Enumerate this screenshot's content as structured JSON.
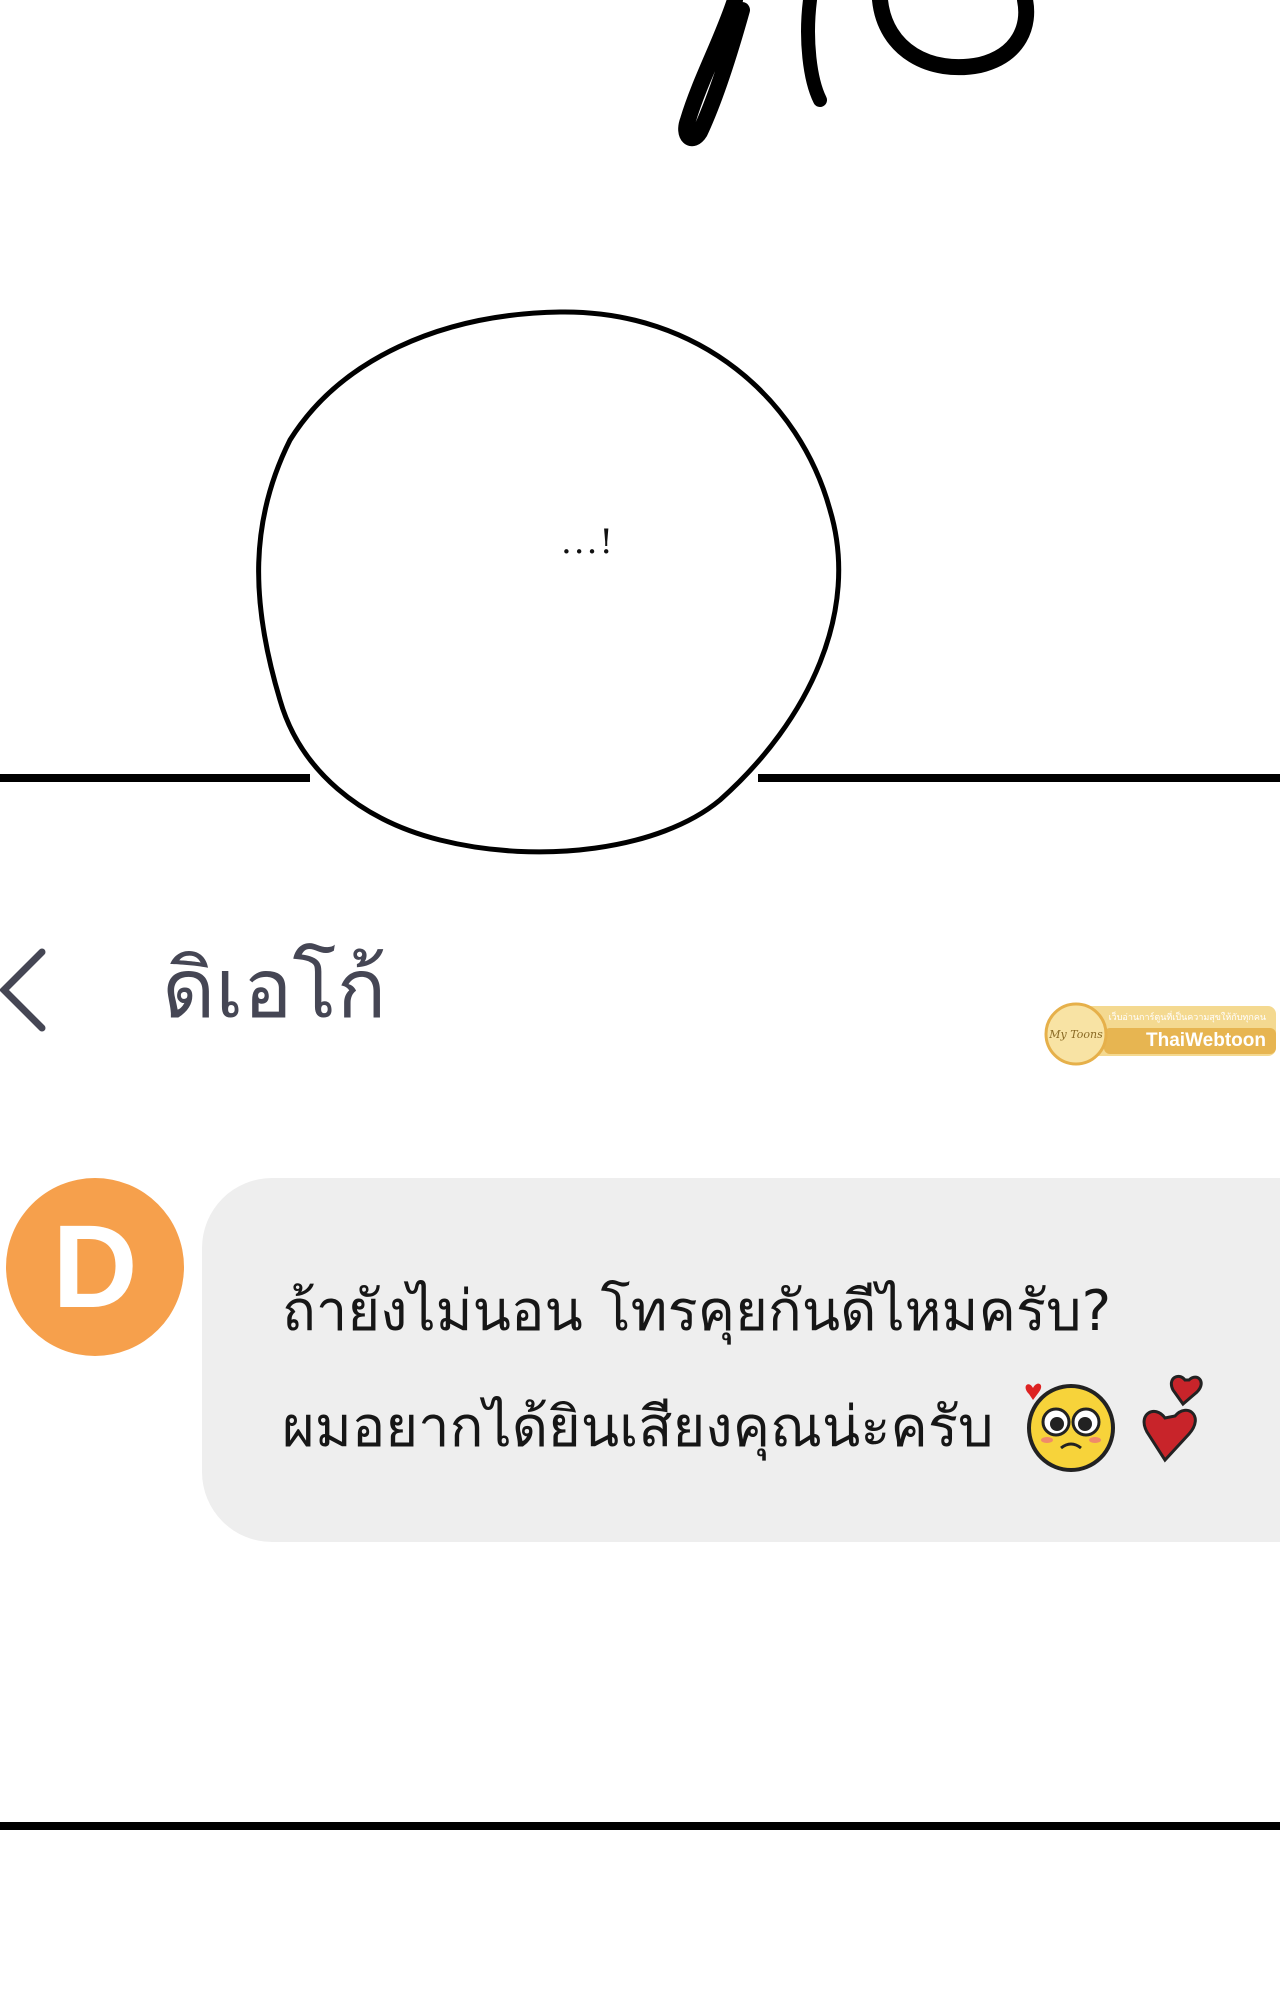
{
  "bubble": {
    "text": "...!"
  },
  "header": {
    "contact_name": "ดิเอโก้"
  },
  "watermark": {
    "brand": "ThaiWebtoon",
    "tagline": "เว็บอ่านการ์ตูนที่เป็นความสุขให้กับทุกคน",
    "logo_text": "My Toons"
  },
  "avatar": {
    "letter": "D",
    "color": "#f6a04c"
  },
  "message": {
    "line1": "ถ้ายังไม่นอน โทรคุยกันดีไหมครับ?",
    "line2": "ผมอยากได้ยินเสียงคุณน่ะครับ",
    "emojis": [
      "pleading-face-icon",
      "hearts-icon"
    ]
  }
}
